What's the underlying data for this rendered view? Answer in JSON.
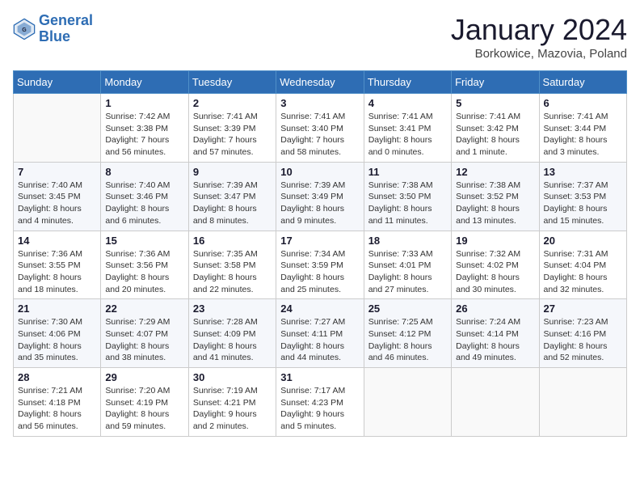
{
  "logo": {
    "line1": "General",
    "line2": "Blue"
  },
  "title": "January 2024",
  "subtitle": "Borkowice, Mazovia, Poland",
  "days_header": [
    "Sunday",
    "Monday",
    "Tuesday",
    "Wednesday",
    "Thursday",
    "Friday",
    "Saturday"
  ],
  "weeks": [
    [
      {
        "num": "",
        "info": ""
      },
      {
        "num": "1",
        "info": "Sunrise: 7:42 AM\nSunset: 3:38 PM\nDaylight: 7 hours\nand 56 minutes."
      },
      {
        "num": "2",
        "info": "Sunrise: 7:41 AM\nSunset: 3:39 PM\nDaylight: 7 hours\nand 57 minutes."
      },
      {
        "num": "3",
        "info": "Sunrise: 7:41 AM\nSunset: 3:40 PM\nDaylight: 7 hours\nand 58 minutes."
      },
      {
        "num": "4",
        "info": "Sunrise: 7:41 AM\nSunset: 3:41 PM\nDaylight: 8 hours\nand 0 minutes."
      },
      {
        "num": "5",
        "info": "Sunrise: 7:41 AM\nSunset: 3:42 PM\nDaylight: 8 hours\nand 1 minute."
      },
      {
        "num": "6",
        "info": "Sunrise: 7:41 AM\nSunset: 3:44 PM\nDaylight: 8 hours\nand 3 minutes."
      }
    ],
    [
      {
        "num": "7",
        "info": "Sunrise: 7:40 AM\nSunset: 3:45 PM\nDaylight: 8 hours\nand 4 minutes."
      },
      {
        "num": "8",
        "info": "Sunrise: 7:40 AM\nSunset: 3:46 PM\nDaylight: 8 hours\nand 6 minutes."
      },
      {
        "num": "9",
        "info": "Sunrise: 7:39 AM\nSunset: 3:47 PM\nDaylight: 8 hours\nand 8 minutes."
      },
      {
        "num": "10",
        "info": "Sunrise: 7:39 AM\nSunset: 3:49 PM\nDaylight: 8 hours\nand 9 minutes."
      },
      {
        "num": "11",
        "info": "Sunrise: 7:38 AM\nSunset: 3:50 PM\nDaylight: 8 hours\nand 11 minutes."
      },
      {
        "num": "12",
        "info": "Sunrise: 7:38 AM\nSunset: 3:52 PM\nDaylight: 8 hours\nand 13 minutes."
      },
      {
        "num": "13",
        "info": "Sunrise: 7:37 AM\nSunset: 3:53 PM\nDaylight: 8 hours\nand 15 minutes."
      }
    ],
    [
      {
        "num": "14",
        "info": "Sunrise: 7:36 AM\nSunset: 3:55 PM\nDaylight: 8 hours\nand 18 minutes."
      },
      {
        "num": "15",
        "info": "Sunrise: 7:36 AM\nSunset: 3:56 PM\nDaylight: 8 hours\nand 20 minutes."
      },
      {
        "num": "16",
        "info": "Sunrise: 7:35 AM\nSunset: 3:58 PM\nDaylight: 8 hours\nand 22 minutes."
      },
      {
        "num": "17",
        "info": "Sunrise: 7:34 AM\nSunset: 3:59 PM\nDaylight: 8 hours\nand 25 minutes."
      },
      {
        "num": "18",
        "info": "Sunrise: 7:33 AM\nSunset: 4:01 PM\nDaylight: 8 hours\nand 27 minutes."
      },
      {
        "num": "19",
        "info": "Sunrise: 7:32 AM\nSunset: 4:02 PM\nDaylight: 8 hours\nand 30 minutes."
      },
      {
        "num": "20",
        "info": "Sunrise: 7:31 AM\nSunset: 4:04 PM\nDaylight: 8 hours\nand 32 minutes."
      }
    ],
    [
      {
        "num": "21",
        "info": "Sunrise: 7:30 AM\nSunset: 4:06 PM\nDaylight: 8 hours\nand 35 minutes."
      },
      {
        "num": "22",
        "info": "Sunrise: 7:29 AM\nSunset: 4:07 PM\nDaylight: 8 hours\nand 38 minutes."
      },
      {
        "num": "23",
        "info": "Sunrise: 7:28 AM\nSunset: 4:09 PM\nDaylight: 8 hours\nand 41 minutes."
      },
      {
        "num": "24",
        "info": "Sunrise: 7:27 AM\nSunset: 4:11 PM\nDaylight: 8 hours\nand 44 minutes."
      },
      {
        "num": "25",
        "info": "Sunrise: 7:25 AM\nSunset: 4:12 PM\nDaylight: 8 hours\nand 46 minutes."
      },
      {
        "num": "26",
        "info": "Sunrise: 7:24 AM\nSunset: 4:14 PM\nDaylight: 8 hours\nand 49 minutes."
      },
      {
        "num": "27",
        "info": "Sunrise: 7:23 AM\nSunset: 4:16 PM\nDaylight: 8 hours\nand 52 minutes."
      }
    ],
    [
      {
        "num": "28",
        "info": "Sunrise: 7:21 AM\nSunset: 4:18 PM\nDaylight: 8 hours\nand 56 minutes."
      },
      {
        "num": "29",
        "info": "Sunrise: 7:20 AM\nSunset: 4:19 PM\nDaylight: 8 hours\nand 59 minutes."
      },
      {
        "num": "30",
        "info": "Sunrise: 7:19 AM\nSunset: 4:21 PM\nDaylight: 9 hours\nand 2 minutes."
      },
      {
        "num": "31",
        "info": "Sunrise: 7:17 AM\nSunset: 4:23 PM\nDaylight: 9 hours\nand 5 minutes."
      },
      {
        "num": "",
        "info": ""
      },
      {
        "num": "",
        "info": ""
      },
      {
        "num": "",
        "info": ""
      }
    ]
  ]
}
